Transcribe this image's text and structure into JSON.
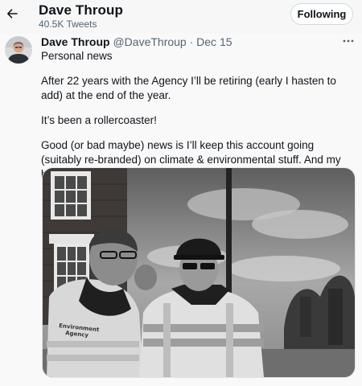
{
  "header": {
    "name": "Dave Throup",
    "tweet_count": "40.5K Tweets",
    "follow_label": "Following"
  },
  "tweet": {
    "author_name": "Dave Throup",
    "handle_date": "@DaveThroup · Dec 15",
    "paragraphs": [
      "Personal news",
      "After 22 years with the Agency I’ll be retiring (early I hasten to add) at the end of the year.",
      "It’s been a rollercoaster!",
      "Good (or bad maybe) news is I’ll keep this account going (suitably re-branded) on climate & environmental stuff. And my bike rides!"
    ],
    "photo_jacket_text": "Environment Agency"
  },
  "icons": {
    "back": "arrow-left-icon",
    "more": "more-horizontal-icon"
  },
  "colors": {
    "text_primary": "#0f1419",
    "text_secondary": "#536471",
    "border": "#cfd9de"
  }
}
